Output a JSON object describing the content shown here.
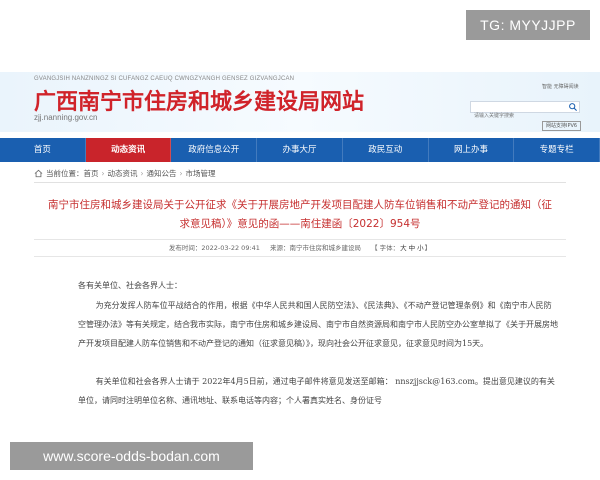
{
  "tg_badge": "TG: MYYJJPP",
  "header": {
    "zhuang_name": "GVANGJSIH NANZNINGZ SI CUFANGZ CAEUQ CWNGZYANGH GENSEZ GIZVANGJCAN",
    "site_title": "广西南宁市住房和城乡建设局网站",
    "domain": "zjj.nanning.gov.cn",
    "links": "智能  无障碍阅读",
    "search_placeholder": "请输入关键字搜索",
    "ipv6": "网站支持IPV6"
  },
  "nav": {
    "items": [
      {
        "label": "首页"
      },
      {
        "label": "动态资讯"
      },
      {
        "label": "政府信息公开"
      },
      {
        "label": "办事大厅"
      },
      {
        "label": "政民互动"
      },
      {
        "label": "网上办事"
      },
      {
        "label": "专题专栏"
      }
    ],
    "active_index": 1
  },
  "breadcrumb": {
    "prefix": "当前位置：",
    "items": [
      "首页",
      "动态资讯",
      "通知公告",
      "市场管理"
    ]
  },
  "article": {
    "title": "南宁市住房和城乡建设局关于公开征求《关于开展房地产开发项目配建人防车位销售和不动产登记的通知（征求意见稿）》意见的函——南住建函〔2022〕954号",
    "published": "发布时间：2022-03-22 09:41",
    "source": "来源：南宁市住房和城乡建设局",
    "font_label": "【 字体：",
    "font_options": [
      "大",
      "中",
      "小"
    ],
    "font_close": "】",
    "greeting": "各有关单位、社会各界人士：",
    "paragraph1": "为充分发挥人防车位平战结合的作用，根据《中华人民共和国人民防空法》、《民法典》、《不动产登记管理条例》和《南宁市人民防空管理办法》等有关规定，结合我市实际，南宁市住房和城乡建设局、南宁市自然资源局和南宁市人民防空办公室草拟了《关于开展房地产开发项目配建人防车位销售和不动产登记的通知（征求意见稿）》，现向社会公开征求意见，征求意见时间为15天。",
    "paragraph2": "有关单位和社会各界人士请于 2022年4月5日前，通过电子邮件将意见发送至邮箱： nnszjjsck@163.com。提出意见建议的有关单位，请同时注明单位名称、通讯地址、联系电话等内容；个人署真实姓名、身份证号"
  },
  "watermark": "www.score-odds-bodan.com",
  "colors": {
    "nav_bg": "#1a5fb0",
    "nav_active": "#c9242b",
    "title_red": "#d0232a",
    "article_title": "#c62f2f"
  }
}
